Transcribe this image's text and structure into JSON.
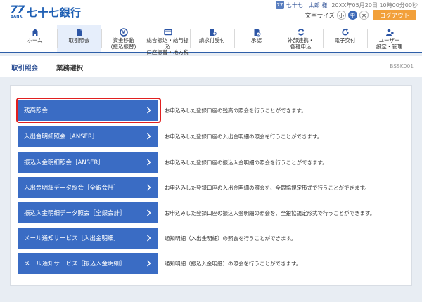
{
  "header": {
    "logo_mark": "77",
    "logo_bank": "BANK",
    "logo_name": "七十七銀行",
    "user_icon": "77",
    "user_name": "七十七　太郎 様",
    "last_login": "20XX年05月20日 10時00分00秒",
    "font_size_label": "文字サイズ",
    "font_sizes": [
      "小",
      "中",
      "大"
    ],
    "font_size_selected": "中",
    "logout_label": "ログアウト"
  },
  "nav": {
    "items": [
      {
        "label": "ホーム",
        "icon": "home-icon"
      },
      {
        "label": "取引照会",
        "icon": "document-icon",
        "active": true
      },
      {
        "label": "資金移動\n(振込振替)",
        "icon": "yen-transfer-icon"
      },
      {
        "label": "総合振込・給与振込\n口座振替・地方税",
        "icon": "card-icon"
      },
      {
        "label": "請求付受付",
        "icon": "person-document-icon"
      },
      {
        "label": "承認",
        "icon": "approve-icon"
      },
      {
        "label": "外部連携・\n各種申込",
        "icon": "sync-icon"
      },
      {
        "label": "電子交付",
        "icon": "refresh-icon"
      },
      {
        "label": "ユーザー\n設定・管理",
        "icon": "user-settings-icon"
      }
    ]
  },
  "breadcrumb": {
    "level1": "取引照会",
    "level2": "業務選択",
    "screen_id": "BSSK001"
  },
  "menu": {
    "items": [
      {
        "label": "残高照会",
        "desc": "お申込みした登録口座の残高の照会を行うことができます。",
        "highlighted": true
      },
      {
        "label": "入出金明細照会［ANSER］",
        "desc": "お申込みした登録口座の入出金明細の照会を行うことができます。"
      },
      {
        "label": "振込入金明細照会［ANSER］",
        "desc": "お申込みした登録口座の振込入金明細の照会を行うことができます。"
      },
      {
        "label": "入出金明細データ照会［全銀会計］",
        "desc": "お申込みした登録口座の入出金明細の照会を、全銀協規定形式で行うことができます。"
      },
      {
        "label": "振込入金明細データ照会［全銀会計］",
        "desc": "お申込みした登録口座の振込入金明細の照会を、全銀協規定形式で行うことができます。"
      },
      {
        "label": "メール通知サービス［入出金明細］",
        "desc": "通知明細（入出金明細）の照会を行うことができます。"
      },
      {
        "label": "メール通知サービス［振込入金明細］",
        "desc": "通知明細（振込入金明細）の照会を行うことができます。"
      }
    ]
  },
  "colors": {
    "brand_blue": "#1e5fb4",
    "button_blue": "#3a6cc4",
    "logout_orange": "#f2a03a",
    "highlight_red": "#e02020"
  }
}
